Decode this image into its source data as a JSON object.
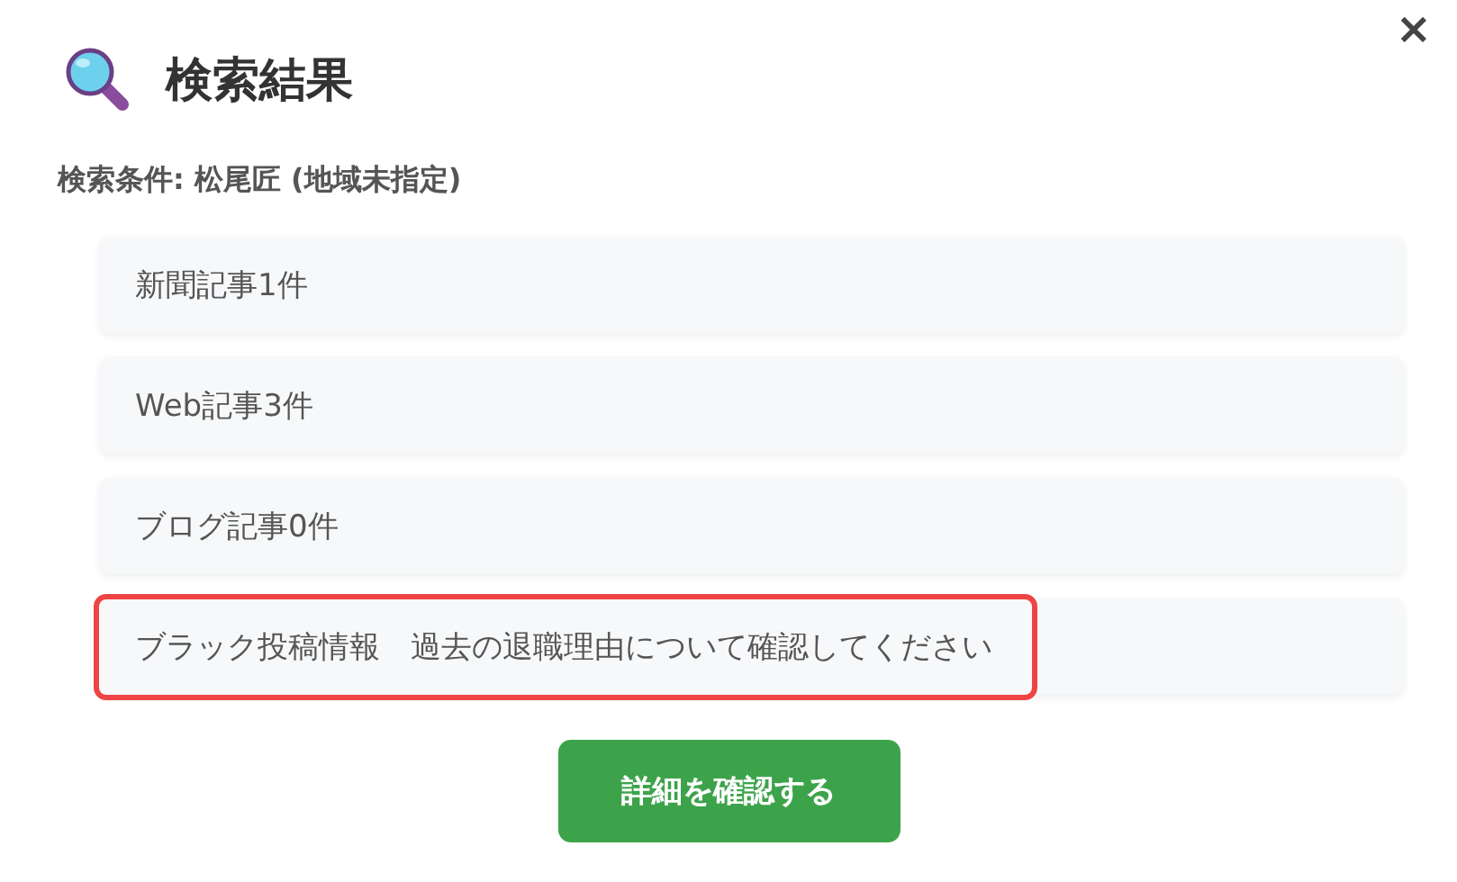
{
  "dialog": {
    "title": "検索結果",
    "close": "×"
  },
  "condition": "検索条件: 松尾匠 (地域未指定)",
  "results": [
    {
      "text": "新聞記事1件",
      "highlighted": false
    },
    {
      "text": "Web記事3件",
      "highlighted": false
    },
    {
      "text": "ブログ記事0件",
      "highlighted": false
    },
    {
      "text": "ブラック投稿情報　過去の退職理由について確認してください",
      "highlighted": true
    }
  ],
  "button": "詳細を確認する"
}
